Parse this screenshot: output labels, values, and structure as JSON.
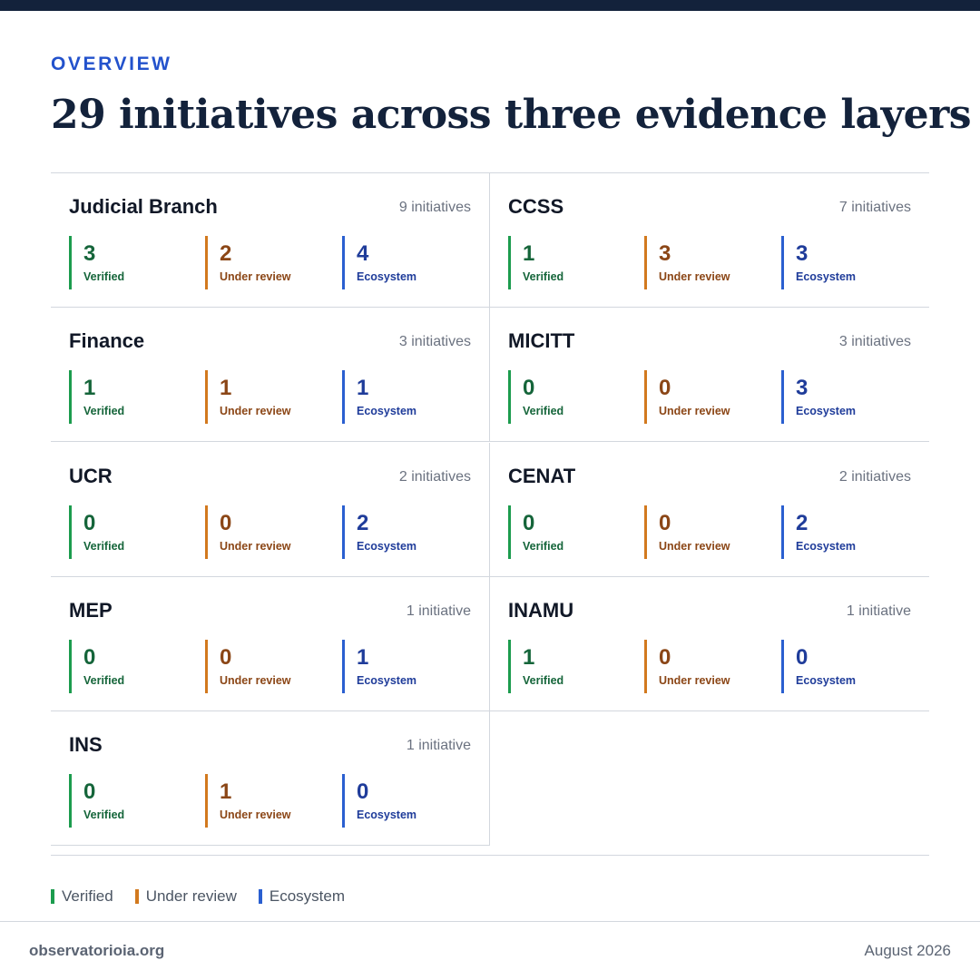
{
  "header": {
    "eyebrow": "OVERVIEW",
    "title": "29 initiatives across three evidence layers"
  },
  "colors": {
    "verified": "#1c9c4e",
    "under_review": "#d2791e",
    "ecosystem": "#2a5fd0",
    "navy": "#13223b",
    "accent": "#2352cc"
  },
  "stat_labels": [
    "Verified",
    "Under review",
    "Ecosystem"
  ],
  "institutions": [
    {
      "name": "Judicial Branch",
      "count": "9 initiatives",
      "values": [
        3,
        2,
        4
      ]
    },
    {
      "name": "CCSS",
      "count": "7 initiatives",
      "values": [
        1,
        3,
        3
      ]
    },
    {
      "name": "Finance",
      "count": "3 initiatives",
      "values": [
        1,
        1,
        1
      ]
    },
    {
      "name": "MICITT",
      "count": "3 initiatives",
      "values": [
        0,
        0,
        3
      ]
    },
    {
      "name": "UCR",
      "count": "2 initiatives",
      "values": [
        0,
        0,
        2
      ]
    },
    {
      "name": "CENAT",
      "count": "2 initiatives",
      "values": [
        0,
        0,
        2
      ]
    },
    {
      "name": "MEP",
      "count": "1 initiative",
      "values": [
        0,
        0,
        1
      ]
    },
    {
      "name": "INAMU",
      "count": "1 initiative",
      "values": [
        1,
        0,
        0
      ]
    },
    {
      "name": "INS",
      "count": "1 initiative",
      "values": [
        0,
        1,
        0
      ]
    }
  ],
  "legend": [
    {
      "label": "Verified",
      "color": "#1c9c4e"
    },
    {
      "label": "Under review",
      "color": "#d2791e"
    },
    {
      "label": "Ecosystem",
      "color": "#2a5fd0"
    }
  ],
  "footer": {
    "site": "observatorioia.org",
    "date": "August 2026"
  }
}
